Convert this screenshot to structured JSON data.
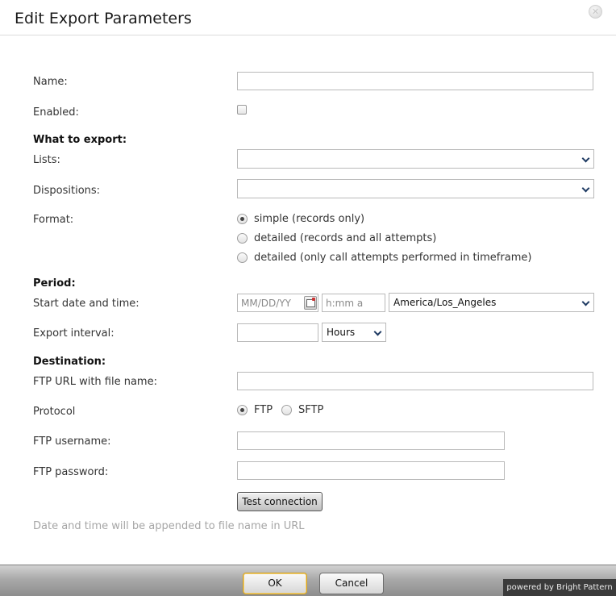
{
  "dialog": {
    "title": "Edit Export Parameters",
    "close_icon": "close-icon"
  },
  "form": {
    "name_label": "Name:",
    "name_value": "",
    "enabled_label": "Enabled:",
    "enabled_checked": false,
    "what_section": "What to export:",
    "lists_label": "Lists:",
    "lists_value": "",
    "dispositions_label": "Dispositions:",
    "dispositions_value": "",
    "format_label": "Format:",
    "format_options": [
      {
        "label": "simple (records only)",
        "checked": true
      },
      {
        "label": "detailed (records and all attempts)",
        "checked": false
      },
      {
        "label": "detailed (only call attempts performed in timeframe)",
        "checked": false
      }
    ],
    "period_section": "Period:",
    "start_label": "Start date and time:",
    "date_placeholder": "MM/DD/YY",
    "time_placeholder": "h:mm a",
    "timezone_value": "America/Los_Angeles",
    "interval_label": "Export interval:",
    "interval_value": "",
    "interval_unit": "Hours",
    "destination_section": "Destination:",
    "ftp_url_label": "FTP URL with file name:",
    "ftp_url_value": "",
    "protocol_label": "Protocol",
    "protocol_options": [
      {
        "label": "FTP",
        "checked": true
      },
      {
        "label": "SFTP",
        "checked": false
      }
    ],
    "ftp_username_label": "FTP username:",
    "ftp_username_value": "",
    "ftp_password_label": "FTP password:",
    "ftp_password_value": "",
    "test_button": "Test connection",
    "hint": "Date and time will be appended to file name in URL"
  },
  "footer": {
    "ok_label": "OK",
    "cancel_label": "Cancel",
    "powered_by": "powered by Bright Pattern"
  }
}
